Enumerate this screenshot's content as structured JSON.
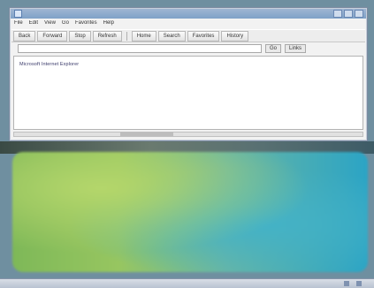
{
  "window": {
    "title": "",
    "menu": [
      "File",
      "Edit",
      "View",
      "Go",
      "Favorites",
      "Help"
    ],
    "toolbar": [
      "Back",
      "Forward",
      "Stop",
      "Refresh",
      "Home",
      "Search",
      "Favorites",
      "History"
    ],
    "address": {
      "label": "",
      "value": "",
      "go_label": "Go",
      "links_label": "Links"
    },
    "content_lines": [
      "Microsoft Internet Explorer",
      "",
      ""
    ]
  },
  "taskbar": {
    "start_label": "",
    "task_label": "",
    "clock": ""
  }
}
